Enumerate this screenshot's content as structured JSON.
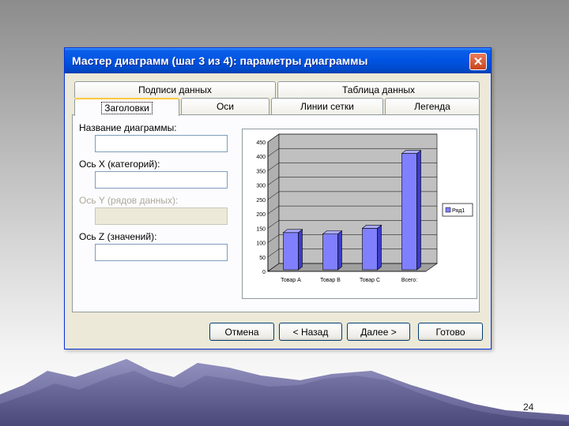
{
  "dialog": {
    "title": "Мастер диаграмм (шаг 3 из 4): параметры диаграммы",
    "close_symbol": "✕"
  },
  "tabs": {
    "row1": [
      "Подписи данных",
      "Таблица данных"
    ],
    "row2": [
      "Заголовки",
      "Оси",
      "Линии сетки",
      "Легенда"
    ],
    "active": "Заголовки"
  },
  "fields": [
    {
      "label": "Название диаграммы:",
      "value": "",
      "enabled": true
    },
    {
      "label": "Ось X (категорий):",
      "value": "",
      "enabled": true
    },
    {
      "label": "Ось Y (рядов данных):",
      "value": "",
      "enabled": false
    },
    {
      "label": "Ось Z (значений):",
      "value": "",
      "enabled": true
    }
  ],
  "buttons": {
    "cancel": "Отмена",
    "back": "< Назад",
    "next": "Далее >",
    "finish": "Готово"
  },
  "chart_data": {
    "type": "bar",
    "style": "3d-column",
    "categories": [
      "Товар A",
      "Товар B",
      "Товар C",
      "Всего:"
    ],
    "series": [
      {
        "name": "Ряд1",
        "values": [
          135,
          130,
          150,
          410
        ]
      }
    ],
    "ylim": [
      0,
      450
    ],
    "yticks": [
      0,
      50,
      100,
      150,
      200,
      250,
      300,
      350,
      400,
      450
    ],
    "grid": true,
    "legend": "right",
    "colors": {
      "bar": "#8080ff",
      "bar_side": "#3c3ccc",
      "bar_top": "#aaaaff",
      "walls": "#c0c0c0"
    }
  },
  "slide": {
    "page_number": "24"
  }
}
